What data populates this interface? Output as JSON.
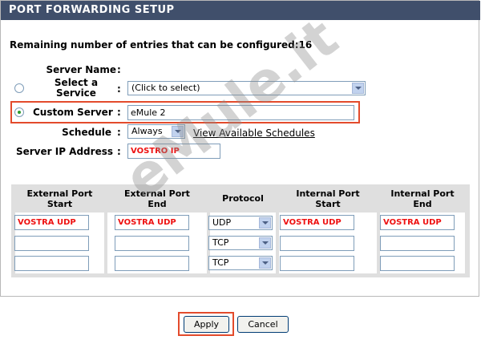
{
  "header": {
    "title": "PORT FORWARDING SETUP"
  },
  "remaining": "Remaining number of entries that can be configured:16",
  "form": {
    "server_name_label": "Server Name",
    "select_service_label_1": "Select a",
    "select_service_label_2": "Service",
    "select_service_value": "(Click to select)",
    "custom_server_label": "Custom Server",
    "custom_server_value": "eMule 2",
    "schedule_label": "Schedule",
    "schedule_value": "Always",
    "view_schedules_link": "View Available Schedules",
    "server_ip_label": "Server IP Address",
    "server_ip_value": "VOSTRO IP",
    "colon": ":"
  },
  "table": {
    "headers": [
      [
        "External Port",
        "Start"
      ],
      [
        "External Port",
        "End"
      ],
      [
        "Protocol",
        ""
      ],
      [
        "Internal Port",
        "Start"
      ],
      [
        "Internal Port",
        "End"
      ]
    ],
    "rows": [
      {
        "ext_start": "VOSTRA UDP",
        "ext_end": "VOSTRA UDP",
        "protocol": "UDP",
        "int_start": "VOSTRA UDP",
        "int_end": "VOSTRA UDP"
      },
      {
        "ext_start": "",
        "ext_end": "",
        "protocol": "TCP",
        "int_start": "",
        "int_end": ""
      },
      {
        "ext_start": "",
        "ext_end": "",
        "protocol": "TCP",
        "int_start": "",
        "int_end": ""
      }
    ]
  },
  "buttons": {
    "apply": "Apply",
    "cancel": "Cancel"
  },
  "watermark": "eMule.it",
  "colors": {
    "header": "#404f6b",
    "highlight": "#e34b2c",
    "red_text": "#e11111"
  }
}
